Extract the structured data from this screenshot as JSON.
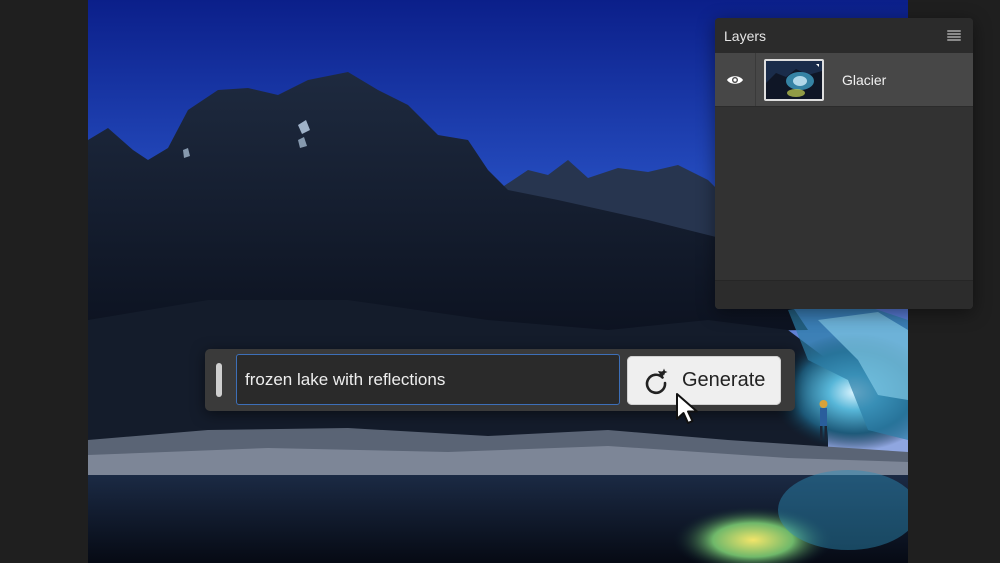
{
  "layers_panel": {
    "title": "Layers",
    "menu_icon": "hamburger-menu-icon",
    "layers": [
      {
        "name": "Glacier",
        "visibility_icon": "eye-icon",
        "visible": true,
        "selected": true
      }
    ]
  },
  "prompt_bar": {
    "input_value": "frozen lake with reflections",
    "generate_label": "Generate",
    "generate_icon": "regenerate-sparkle-icon"
  },
  "colors": {
    "accent_blue": "#3d6fb8",
    "panel_bg": "#323232",
    "row_selected": "#474747"
  }
}
